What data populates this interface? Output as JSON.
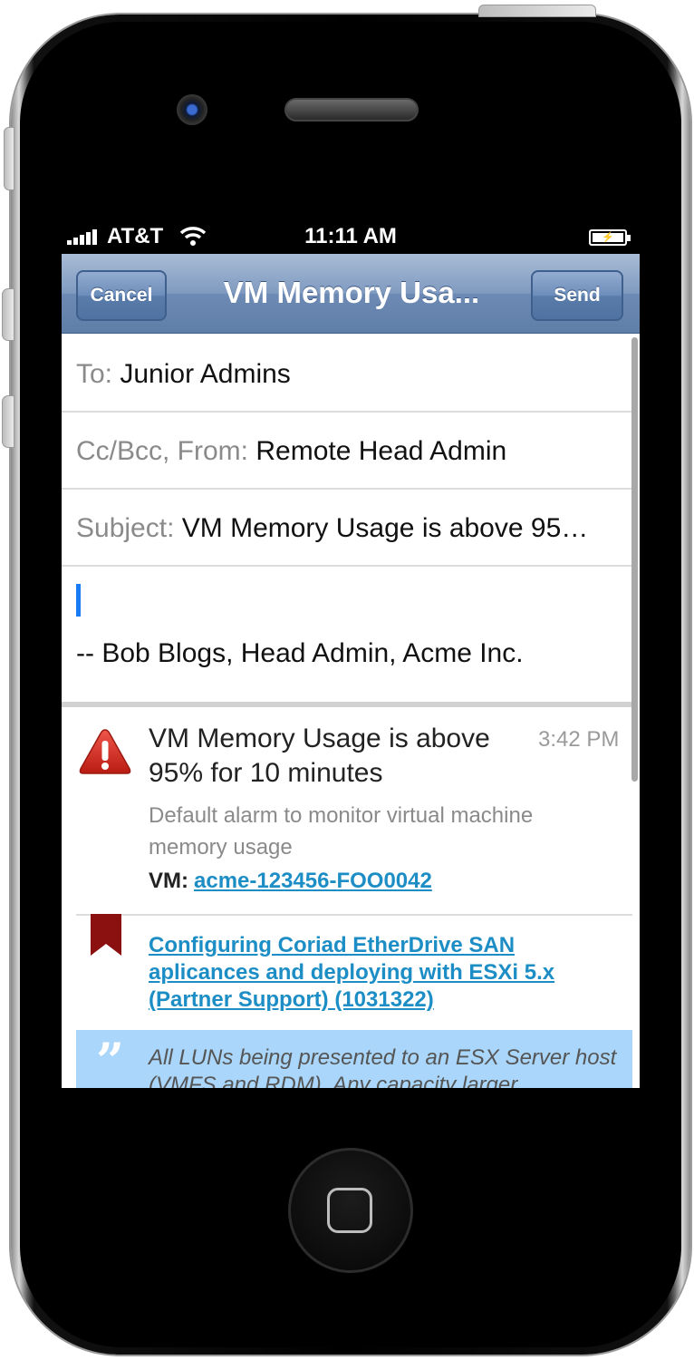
{
  "status_bar": {
    "carrier": "AT&T",
    "time": "11:11 AM"
  },
  "navbar": {
    "cancel_label": "Cancel",
    "title": "VM Memory Usa...",
    "send_label": "Send"
  },
  "compose": {
    "to_label": "To:",
    "to_value": "Junior Admins",
    "cc_label": "Cc/Bcc, From:",
    "cc_value": "Remote Head Admin",
    "subject_label": "Subject:",
    "subject_value": "VM Memory Usage is above 95…",
    "signature": "-- Bob Blogs, Head Admin, Acme Inc."
  },
  "alert": {
    "title": "VM Memory Usage is above 95% for 10 minutes",
    "time": "3:42 PM",
    "description": "Default alarm to monitor virtual machine memory usage",
    "vm_label": "VM:",
    "vm_link": "acme-123456-FOO0042",
    "icon": "warning-triangle"
  },
  "kb_article": {
    "link": "Configuring Coriad EtherDrive SAN aplicances and deploying with ESXi 5.x (Partner Support) (1031322)",
    "icon": "bookmark-ribbon"
  },
  "quote": {
    "text": "All LUNs being presented to an ESX Server host (VMFS and RDM). Any capacity larger"
  },
  "colors": {
    "nav_blue": "#6d8ab4",
    "link_blue": "#1d8ec5",
    "caret_blue": "#1a7cf5",
    "alert_red": "#d92b1e",
    "ribbon_red": "#8b1010",
    "quote_bg": "#a9d6fa"
  }
}
